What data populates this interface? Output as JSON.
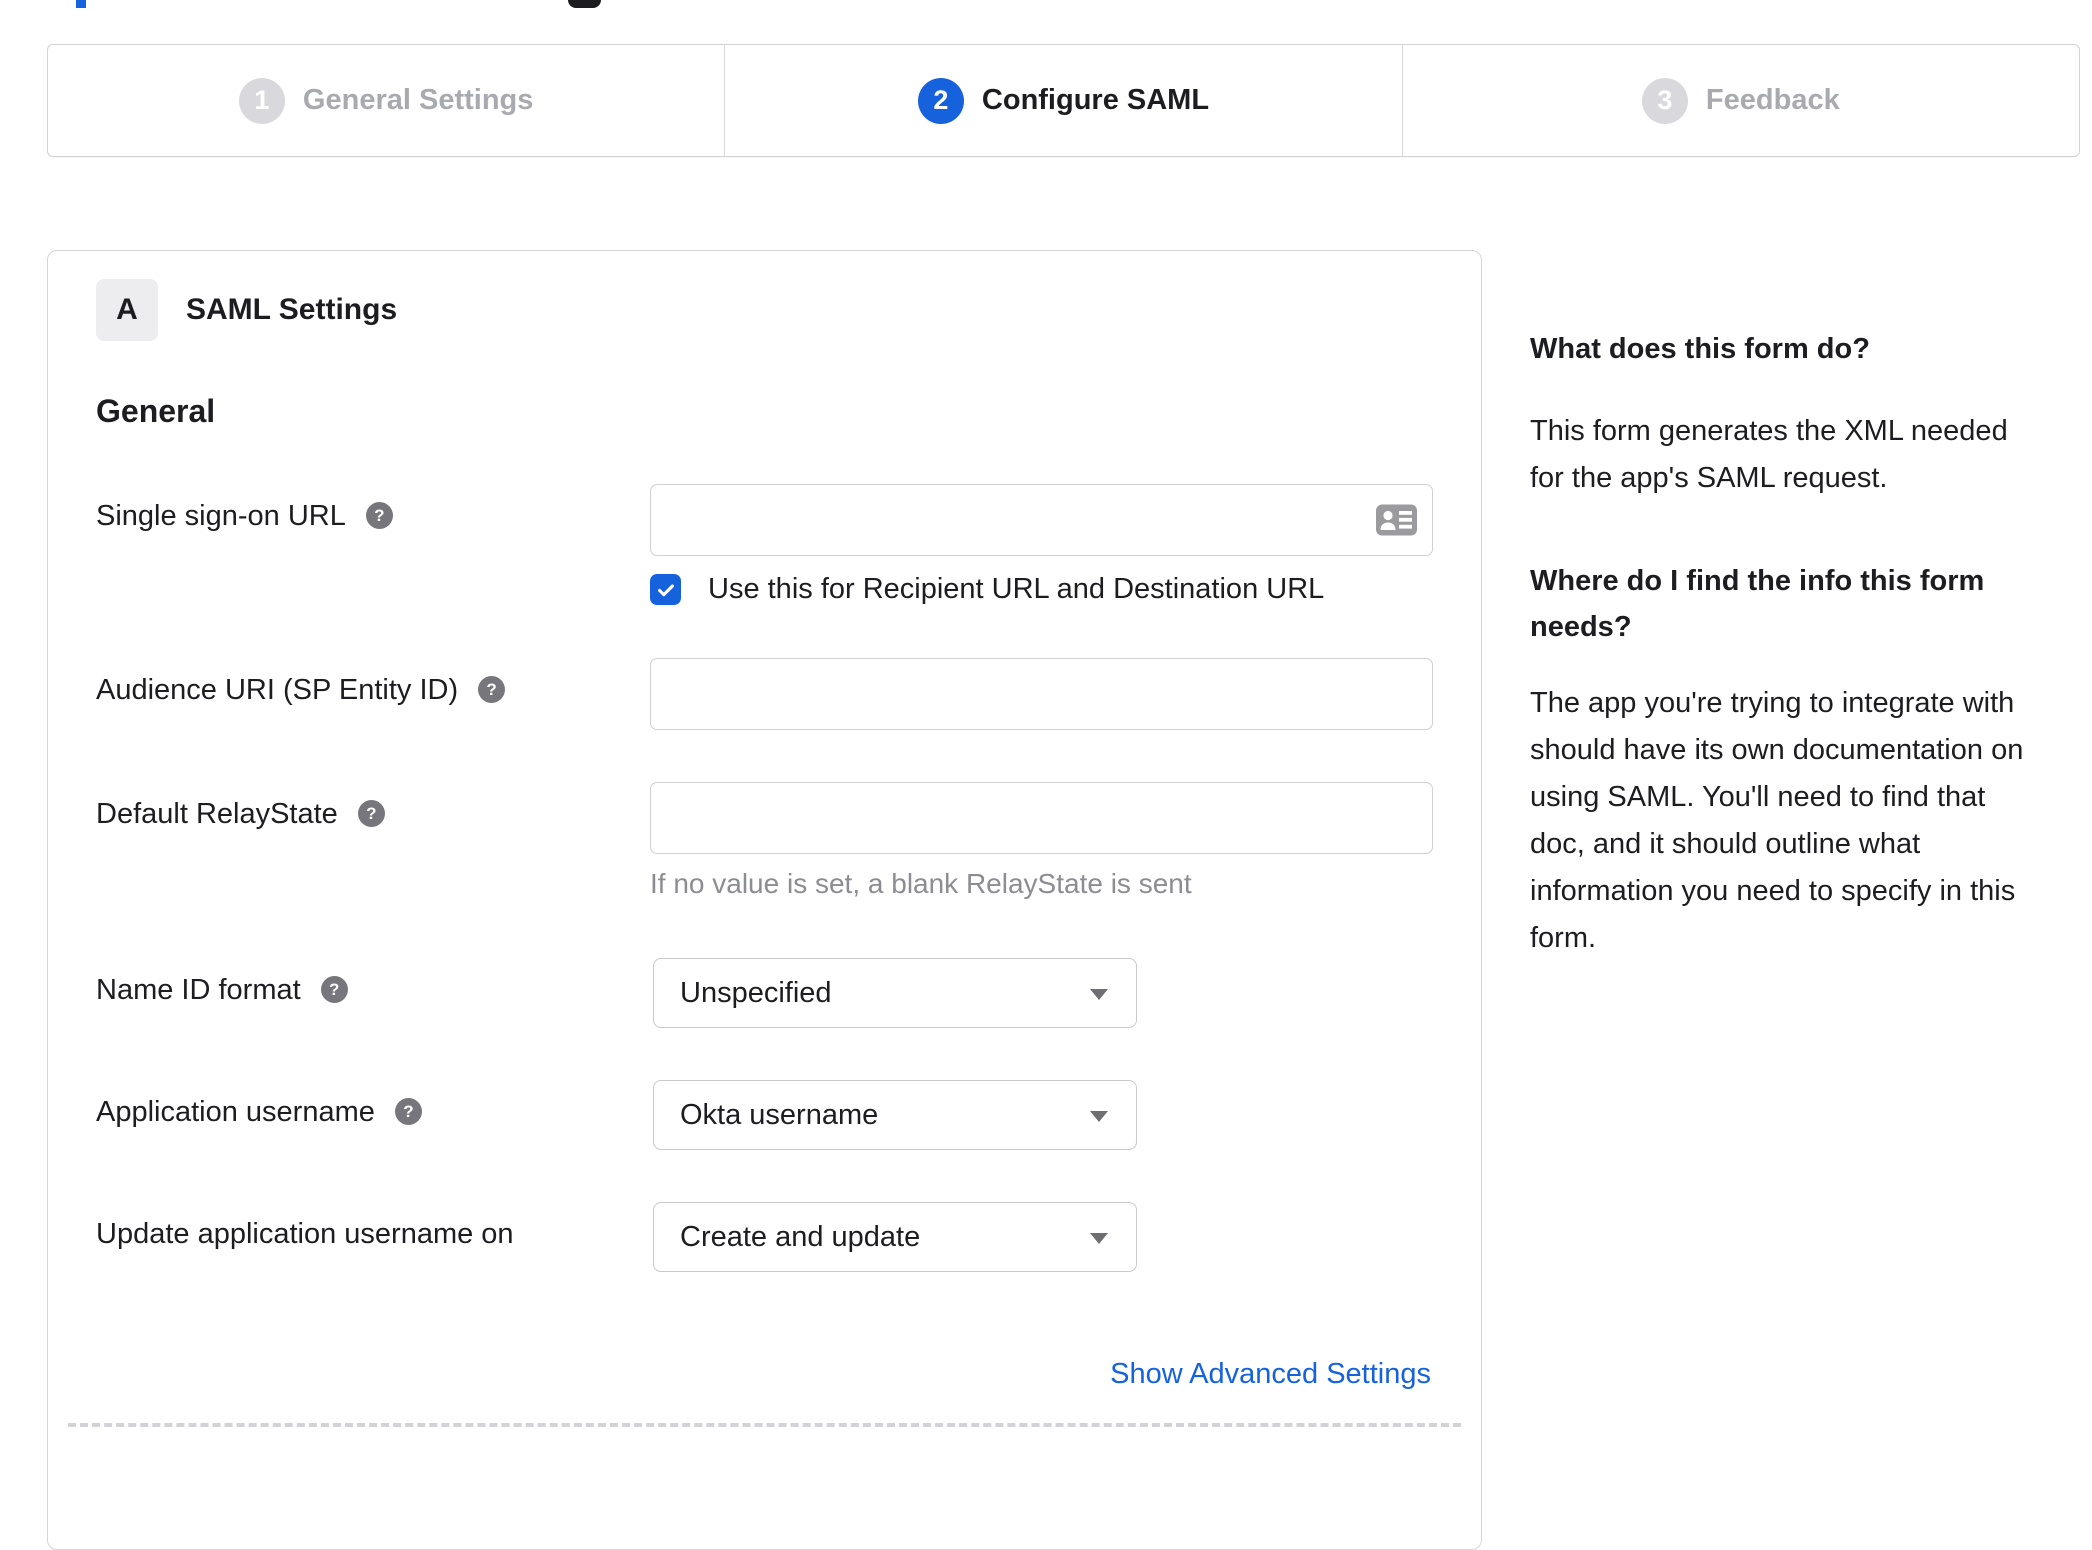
{
  "stepper": {
    "steps": [
      {
        "number": "1",
        "label": "General Settings",
        "state": "inactive"
      },
      {
        "number": "2",
        "label": "Configure SAML",
        "state": "active"
      },
      {
        "number": "3",
        "label": "Feedback",
        "state": "inactive"
      }
    ]
  },
  "panel": {
    "badge": "A",
    "title": "SAML Settings",
    "section": "General",
    "fields": {
      "sso": {
        "label": "Single sign-on URL",
        "value": "",
        "checkbox_label": "Use this for Recipient URL and Destination URL",
        "checkbox_checked": true
      },
      "audience": {
        "label": "Audience URI (SP Entity ID)",
        "value": ""
      },
      "relay": {
        "label": "Default RelayState",
        "value": "",
        "hint": "If no value is set, a blank RelayState is sent"
      },
      "name_id_format": {
        "label": "Name ID format",
        "value": "Unspecified"
      },
      "app_username": {
        "label": "Application username",
        "value": "Okta username"
      },
      "update_username": {
        "label": "Update application username on",
        "value": "Create and update"
      }
    },
    "advanced_link": "Show Advanced Settings"
  },
  "help_panel": {
    "q1": "What does this form do?",
    "a1": "This form generates the XML needed for the app's SAML request.",
    "q2": "Where do I find the info this form needs?",
    "a2": "The app you're trying to integrate with should have its own documentation on using SAML. You'll need to find that doc, and it should outline what information you need to specify in this form."
  },
  "icons": {
    "help": "?"
  },
  "colors": {
    "accent": "#1662dd",
    "active_text": "#1d1d21",
    "inactive_text": "#a9a9b0",
    "border": "#cdcdd2",
    "hint_text": "#8c8c93"
  }
}
